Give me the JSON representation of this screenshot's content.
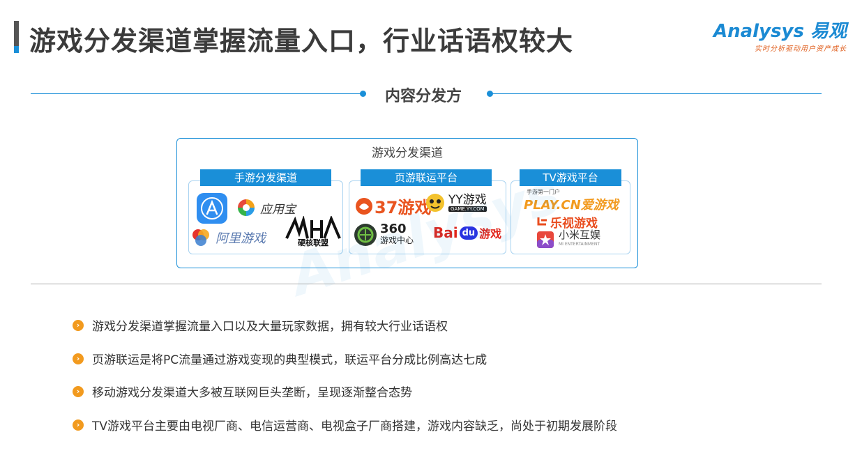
{
  "header": {
    "title": "游戏分发渠道掌握流量入口，行业话语权较大",
    "brand_name": "Analysys 易观",
    "brand_slogan": "实时分析驱动用户资产成长"
  },
  "section": {
    "title": "内容分发方"
  },
  "channels": {
    "title": "游戏分发渠道",
    "groups": [
      {
        "label": "手游分发渠道",
        "logos": [
          "应用宝",
          "阿里游戏",
          "硬核联盟"
        ]
      },
      {
        "label": "页游联运平台",
        "logos": [
          "37游戏",
          "YY游戏",
          "GAME.YY.COM",
          "360",
          "游戏中心",
          "Bai",
          "du",
          "游戏"
        ]
      },
      {
        "label": "TV游戏平台",
        "logos": [
          "手游第一门户",
          "PLAY.CN爱游戏",
          "乐视游戏",
          "小米互娱",
          "MI ENTERTAINMENT"
        ]
      }
    ]
  },
  "bullets": [
    "游戏分发渠道掌握流量入口以及大量玩家数据，拥有较大行业话语权",
    "页游联运是将PC流量通过游戏变现的典型模式，联运平台分成比例高达七成",
    "移动游戏分发渠道大多被互联网巨头垄断，呈现逐渐整合态势",
    "TV游戏平台主要由电视厂商、电信运营商、电视盒子厂商搭建，游戏内容缺乏，尚处于初期发展阶段"
  ],
  "colors": {
    "accent": "#1a8fd8",
    "bullet": "#f29a1e",
    "title": "#3b3b3b"
  }
}
